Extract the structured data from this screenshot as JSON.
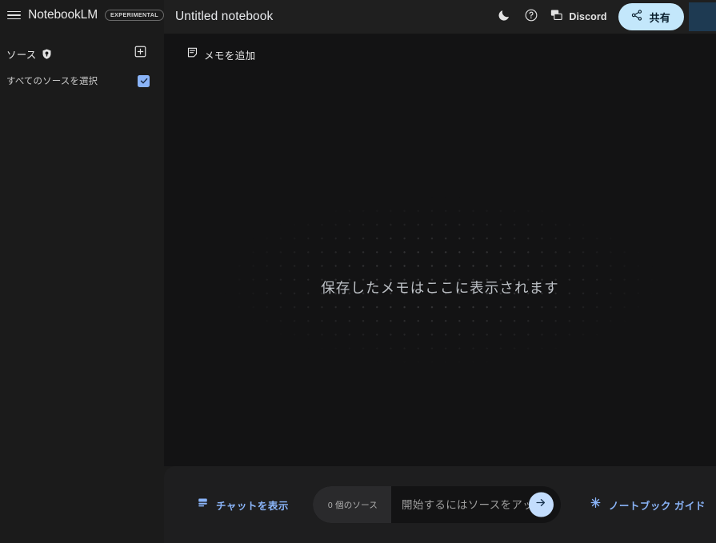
{
  "brand": {
    "app_name": "NotebookLM",
    "badge": "EXPERIMENTAL",
    "menu_icon": "hamburger-menu-icon"
  },
  "header": {
    "notebook_title": "Untitled notebook",
    "theme_icon": "moon-icon",
    "help_icon": "question-mark-circle-icon",
    "discord_icon": "discord-chat-icon",
    "discord_label": "Discord",
    "share_icon": "share-nodes-icon",
    "share_label": "共有",
    "avatar": "user-avatar"
  },
  "sidebar": {
    "sources_label": "ソース",
    "sources_icon": "shield-badge-icon",
    "add_source_icon": "add-box-icon",
    "select_all_label": "すべてのソースを選択",
    "select_all_checked": true
  },
  "main": {
    "add_note_icon": "note-add-icon",
    "add_note_label": "メモを追加",
    "empty_state_text": "保存したメモはここに表示されます"
  },
  "bottom": {
    "chat_icon": "chat-panel-icon",
    "chat_label": "チャットを表示",
    "source_count_label": "0 個のソース",
    "composer_placeholder": "開始するにはソースをアップ",
    "composer_value": "",
    "send_icon": "arrow-right-icon",
    "guide_icon": "sparkle-icon",
    "guide_label": "ノートブック ガイド"
  },
  "colors": {
    "accent_blue": "#8ab4f8",
    "share_bg": "#c3e7fb",
    "panel_bg": "#131314",
    "shell_bg": "#1b1b1b",
    "bottom_bg": "#1e1e1f"
  }
}
